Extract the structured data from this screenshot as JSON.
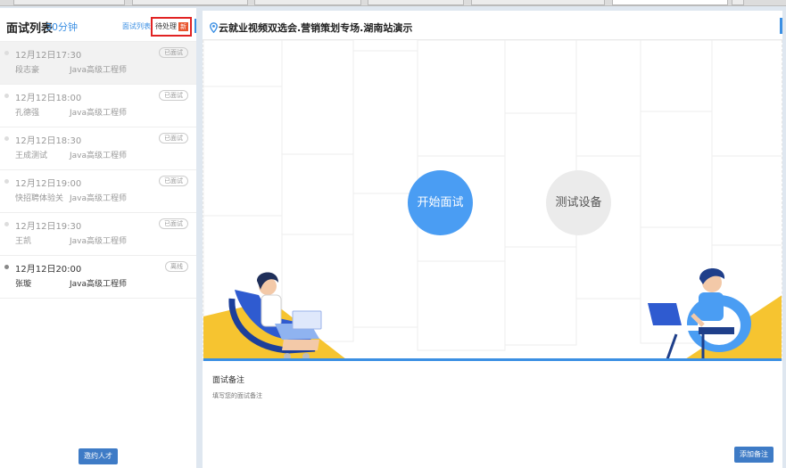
{
  "browser_tabs": [
    "",
    "",
    "",
    "",
    "",
    "",
    ""
  ],
  "sidebar": {
    "title": "面试列表",
    "duration": "30分钟",
    "tab_list_label": "面试列表",
    "tab_pending_label": "待处理",
    "tab_pending_badge": "新",
    "items": [
      {
        "time": "12月12日17:30",
        "name": "段志豪",
        "job": "Java高级工程师",
        "status": "已面试"
      },
      {
        "time": "12月12日18:00",
        "name": "孔德强",
        "job": "Java高级工程师",
        "status": "已面试"
      },
      {
        "time": "12月12日18:30",
        "name": "王成测试",
        "job": "Java高级工程师",
        "status": "已面试"
      },
      {
        "time": "12月12日19:00",
        "name": "快招聘体验关",
        "job": "Java高级工程师",
        "status": "已面试"
      },
      {
        "time": "12月12日19:30",
        "name": "王凯",
        "job": "Java高级工程师",
        "status": "已面试"
      },
      {
        "time": "12月12日20:00",
        "name": "张璇",
        "job": "Java高级工程师",
        "status": "离线"
      }
    ],
    "invite_button": "邀约人才"
  },
  "main": {
    "title": "云就业视频双选会.营销策划专场.湖南站演示",
    "start_button": "开始面试",
    "test_button": "测试设备",
    "notes_label": "面试备注",
    "notes_placeholder": "填写您的面试备注",
    "add_note_button": "添加备注"
  },
  "colors": {
    "accent": "#3b8fe3",
    "start_button": "#4a9df3",
    "highlight_border": "#e12323",
    "illustration_yellow": "#f6c430"
  },
  "icons": {
    "location": "location-pin-icon"
  }
}
